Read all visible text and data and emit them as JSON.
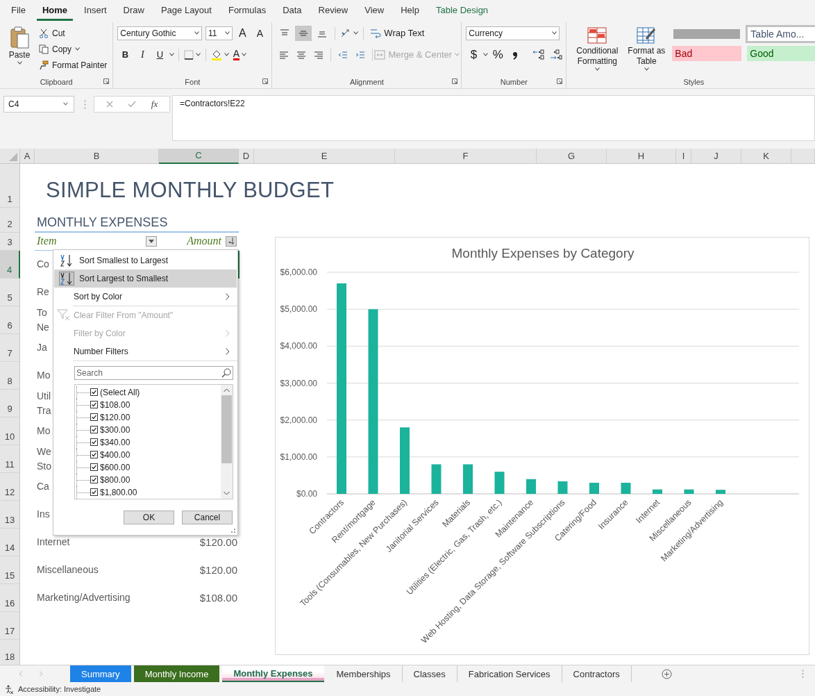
{
  "ribbon_tabs": [
    {
      "label": "File",
      "selected": false,
      "kind": "standard"
    },
    {
      "label": "Home",
      "selected": true,
      "kind": "standard"
    },
    {
      "label": "Insert",
      "selected": false,
      "kind": "standard"
    },
    {
      "label": "Draw",
      "selected": false,
      "kind": "standard"
    },
    {
      "label": "Page Layout",
      "selected": false,
      "kind": "standard"
    },
    {
      "label": "Formulas",
      "selected": false,
      "kind": "standard"
    },
    {
      "label": "Data",
      "selected": false,
      "kind": "standard"
    },
    {
      "label": "Review",
      "selected": false,
      "kind": "standard"
    },
    {
      "label": "View",
      "selected": false,
      "kind": "standard"
    },
    {
      "label": "Help",
      "selected": false,
      "kind": "standard"
    },
    {
      "label": "Table Design",
      "selected": false,
      "kind": "contextual"
    }
  ],
  "ribbon": {
    "clipboard": {
      "label": "Clipboard",
      "paste": "Paste",
      "cut": "Cut",
      "copy": "Copy",
      "format_painter": "Format Painter"
    },
    "font": {
      "label": "Font",
      "font_name": "Century Gothic",
      "font_size": "11",
      "grow": "A",
      "shrink": "A",
      "bold": "B",
      "italic": "I",
      "underline": "U",
      "font_color": "A"
    },
    "alignment": {
      "label": "Alignment",
      "wrap_text": "Wrap Text",
      "merge_center": {
        "label": "Merge & Center",
        "disabled": true
      },
      "vertical_align": [
        {
          "kind": "top",
          "selected": false
        },
        {
          "kind": "middle",
          "selected": true
        },
        {
          "kind": "bottom",
          "selected": false
        }
      ]
    },
    "number": {
      "label": "Number",
      "format": "Currency",
      "currency": "$",
      "percent": "%"
    },
    "styles": {
      "label": "Styles",
      "conditional_formatting": "Conditional Formatting",
      "format_as_table": "Format as Table",
      "gallery": [
        {
          "kind": "heading",
          "selected": false
        },
        {
          "kind": "table-amount",
          "text": "Table Amo...",
          "selected": true
        },
        {
          "kind": "bad",
          "text": "Bad",
          "selected": false
        },
        {
          "kind": "good",
          "text": "Good",
          "selected": false
        }
      ]
    }
  },
  "formula_bar": {
    "name_box": "C4",
    "function_label": "fx",
    "formula": "=Contractors!E22"
  },
  "columns": [
    {
      "label": "A",
      "selected": false
    },
    {
      "label": "B",
      "selected": false
    },
    {
      "label": "C",
      "selected": true
    },
    {
      "label": "D",
      "selected": false
    },
    {
      "label": "E",
      "selected": false
    },
    {
      "label": "F",
      "selected": false
    },
    {
      "label": "G",
      "selected": false
    },
    {
      "label": "H",
      "selected": false
    },
    {
      "label": "I",
      "selected": false
    },
    {
      "label": "J",
      "selected": false
    },
    {
      "label": "K",
      "selected": false
    }
  ],
  "row_numbers": [
    {
      "label": "1",
      "selected": false
    },
    {
      "label": "2",
      "selected": false
    },
    {
      "label": "3",
      "selected": false
    },
    {
      "label": "4",
      "selected": true
    },
    {
      "label": "5",
      "selected": false
    },
    {
      "label": "6",
      "selected": false
    },
    {
      "label": "7",
      "selected": false
    },
    {
      "label": "8",
      "selected": false
    },
    {
      "label": "9",
      "selected": false
    },
    {
      "label": "10",
      "selected": false
    },
    {
      "label": "11",
      "selected": false
    },
    {
      "label": "12",
      "selected": false
    },
    {
      "label": "13",
      "selected": false
    },
    {
      "label": "14",
      "selected": false
    },
    {
      "label": "15",
      "selected": false
    },
    {
      "label": "16",
      "selected": false
    },
    {
      "label": "17",
      "selected": false
    },
    {
      "label": "18",
      "selected": false
    }
  ],
  "sheet": {
    "title": "SIMPLE MONTHLY BUDGET",
    "subtitle": "MONTHLY EXPENSES",
    "headers": [
      {
        "label": "Item",
        "kind": "dropdown"
      },
      {
        "label": "Amount",
        "kind": "sort-desc"
      }
    ],
    "items": [
      {
        "lines": [
          "Co"
        ]
      },
      {
        "lines": [
          "Re"
        ]
      },
      {
        "lines": [
          "To",
          "Ne"
        ]
      },
      {
        "lines": [
          "Ja"
        ]
      },
      {
        "lines": [
          "Mo"
        ]
      },
      {
        "lines": [
          "Util",
          "Tra"
        ]
      },
      {
        "lines": [
          "Mo"
        ]
      },
      {
        "lines": [
          "We",
          "Sto"
        ]
      },
      {
        "lines": [
          "Ca"
        ]
      },
      {
        "lines": [
          "Ins"
        ]
      },
      {
        "lines": [
          "Internet"
        ],
        "amount": "$120.00"
      },
      {
        "lines": [
          "Miscellaneous"
        ],
        "amount": "$120.00"
      },
      {
        "lines": [
          "Marketing/Advertising"
        ],
        "amount": "$108.00"
      }
    ]
  },
  "filter_menu": {
    "items": [
      {
        "kind": "sort-asc",
        "label": "Sort Smallest to Largest",
        "selected": false,
        "disabled": false
      },
      {
        "kind": "sort-desc",
        "label": "Sort Largest to Smallest",
        "selected": true,
        "disabled": false
      },
      {
        "kind": "submenu",
        "label": "Sort by Color",
        "selected": false,
        "disabled": false
      },
      {
        "kind": "separator"
      },
      {
        "kind": "clear",
        "label": "Clear Filter From \"Amount\"",
        "selected": false,
        "disabled": true
      },
      {
        "kind": "submenu",
        "label": "Filter by Color",
        "selected": false,
        "disabled": true
      },
      {
        "kind": "submenu",
        "label": "Number Filters",
        "selected": false,
        "disabled": false
      },
      {
        "kind": "separator"
      }
    ],
    "search": {
      "placeholder": "Search"
    },
    "values": [
      {
        "label": "(Select All)",
        "checked": true
      },
      {
        "label": "$108.00",
        "checked": true
      },
      {
        "label": "$120.00",
        "checked": true
      },
      {
        "label": "$300.00",
        "checked": true
      },
      {
        "label": "$340.00",
        "checked": true
      },
      {
        "label": "$400.00",
        "checked": true
      },
      {
        "label": "$600.00",
        "checked": true
      },
      {
        "label": "$800.00",
        "checked": true
      },
      {
        "label": "$1,800.00",
        "checked": true
      }
    ],
    "buttons": [
      "OK",
      "Cancel"
    ]
  },
  "chart": {
    "chart_data": {
      "type": "bar",
      "title": "Monthly Expenses by Category",
      "categories": [
        "Contractors",
        "Rent/mortgage",
        "Tools (Consumables, New Purchases)",
        "Janitorial Services",
        "Materials",
        "Utilities (Electric, Gas, Trash, etc.)",
        "Maintenance",
        "Web Hosting, Data Storage, Software Subscriptions",
        "Catering/Food",
        "Insurance",
        "Internet",
        "Miscellaneous",
        "Marketing/Advertising"
      ],
      "series": [
        {
          "color": "#1bb39b",
          "values": [
            5700,
            5000,
            1800,
            800,
            800,
            600,
            400,
            340,
            300,
            300,
            120,
            120,
            110
          ]
        }
      ],
      "grid": true,
      "ylim": [
        0,
        6000
      ],
      "yticks": [
        {
          "value": 0,
          "label": "$0.00"
        },
        {
          "value": 1000,
          "label": "$1,000.00"
        },
        {
          "value": 2000,
          "label": "$2,000.00"
        },
        {
          "value": 3000,
          "label": "$3,000.00"
        },
        {
          "value": 4000,
          "label": "$4,000.00"
        },
        {
          "value": 5000,
          "label": "$5,000.00"
        },
        {
          "value": 6000,
          "label": "$6,000.00"
        }
      ]
    }
  },
  "sheet_tabs": [
    {
      "label": "Summary",
      "selected": false,
      "color": "#1e82e6"
    },
    {
      "label": "Monthly Income",
      "selected": false,
      "color": "#3b6e1e"
    },
    {
      "label": "Monthly Expenses",
      "selected": true,
      "color": "#e6a3c3"
    },
    {
      "label": "Memberships",
      "selected": false
    },
    {
      "label": "Classes",
      "selected": false
    },
    {
      "label": "Fabrication Services",
      "selected": false
    },
    {
      "label": "Contractors",
      "selected": false
    }
  ],
  "status_bar": {
    "accessibility": "Accessibility: Investigate"
  }
}
